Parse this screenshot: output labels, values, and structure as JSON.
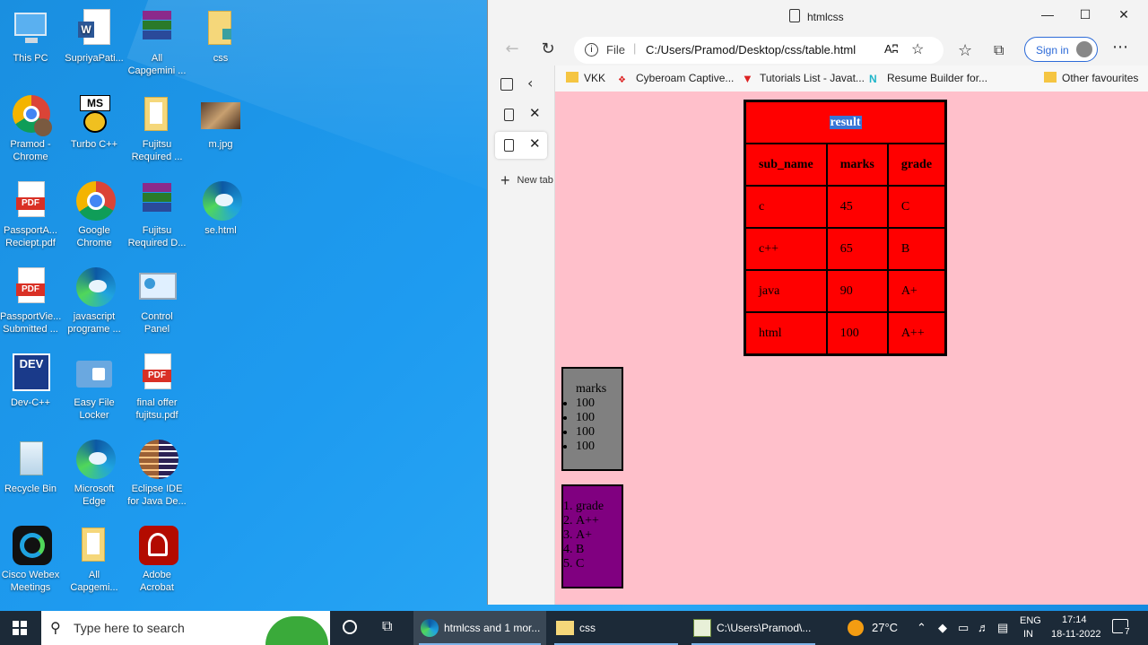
{
  "desktop": {
    "icons": [
      {
        "label": "This PC"
      },
      {
        "label": "SupriyaPati..."
      },
      {
        "label": "All\nCapgemini ..."
      },
      {
        "label": "css"
      },
      {
        "label": "Pramod -\nChrome"
      },
      {
        "label": "Turbo C++"
      },
      {
        "label": "Fujitsu\nRequired ..."
      },
      {
        "label": "m.jpg"
      },
      {
        "label": "PassportA...\nReciept.pdf"
      },
      {
        "label": "Google\nChrome"
      },
      {
        "label": "Fujitsu\nRequired D..."
      },
      {
        "label": "se.html"
      },
      {
        "label": "PassportVie...\nSubmitted ..."
      },
      {
        "label": "javascript\nprograme ..."
      },
      {
        "label": "Control\nPanel"
      },
      {
        "label": "Dev-C++"
      },
      {
        "label": "Easy File\nLocker"
      },
      {
        "label": "final offer\nfujitsu.pdf"
      },
      {
        "label": "Recycle Bin"
      },
      {
        "label": "Microsoft\nEdge"
      },
      {
        "label": "Eclipse IDE\nfor Java De..."
      },
      {
        "label": "Cisco Webex\nMeetings"
      },
      {
        "label": "All\nCapgemi..."
      },
      {
        "label": "Adobe\nAcrobat"
      }
    ],
    "pdf_text": "PDF",
    "dev_text": "DEV",
    "ms_text": "MS"
  },
  "browser": {
    "title": "htmlcss",
    "address": {
      "scheme_label": "File",
      "url": "C:/Users/Pramod/Desktop/css/table.html",
      "read_aloud": "Aʭ"
    },
    "sign_in": "Sign in",
    "favourites": [
      {
        "label": "VKK"
      },
      {
        "label": "Cyberoam Captive..."
      },
      {
        "label": "Tutorials List - Javat..."
      },
      {
        "label": "Resume Builder for..."
      },
      {
        "label": "Other favourites"
      }
    ],
    "new_tab": "New tab"
  },
  "page": {
    "table": {
      "caption": "result",
      "headers": [
        "sub_name",
        "marks",
        "grade"
      ],
      "rows": [
        [
          "c",
          "45",
          "C"
        ],
        [
          "c++",
          "65",
          "B"
        ],
        [
          "java",
          "90",
          "A+"
        ],
        [
          "html",
          "100",
          "A++"
        ]
      ]
    },
    "marks_box": {
      "heading": "marks",
      "items": [
        "100",
        "100",
        "100",
        "100"
      ]
    },
    "grade_box": {
      "items": [
        "grade",
        "A++",
        "A+",
        "B",
        "C"
      ]
    }
  },
  "taskbar": {
    "search_placeholder": "Type here to search",
    "items": [
      {
        "label": "htmlcss and 1 mor..."
      },
      {
        "label": "css"
      },
      {
        "label": "C:\\Users\\Pramod\\..."
      }
    ],
    "weather": "27°C",
    "language_1": "ENG",
    "language_2": "IN",
    "time": "17:14",
    "date": "18-11-2022",
    "notification_count": "7"
  }
}
